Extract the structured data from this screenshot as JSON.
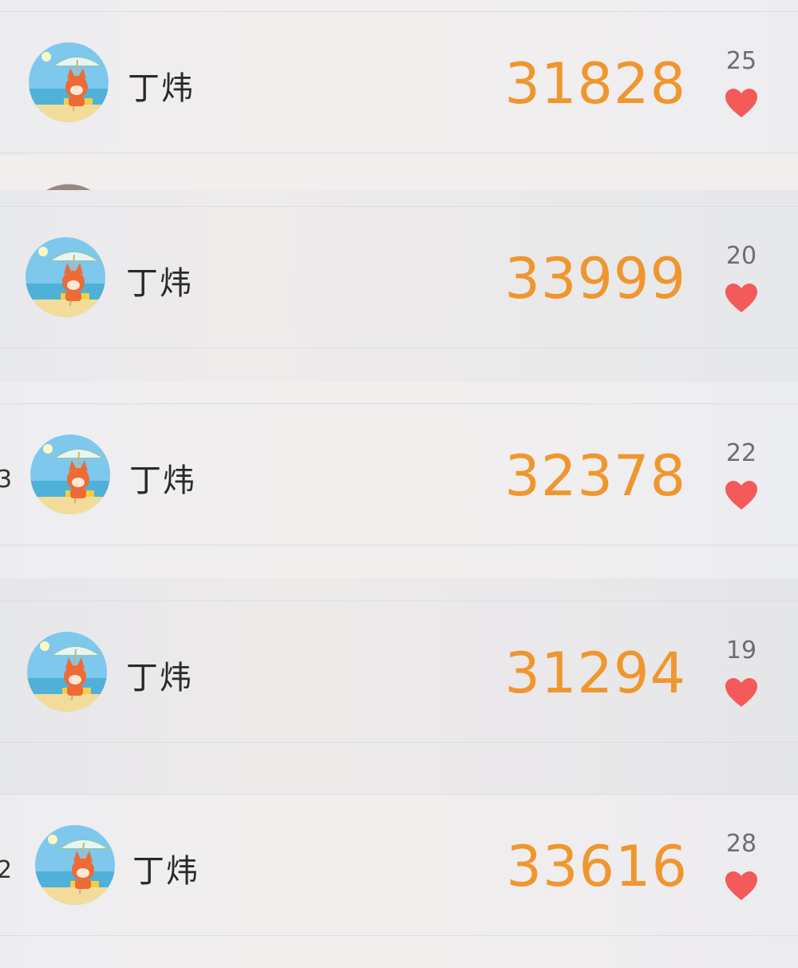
{
  "rows": [
    {
      "name": "丁炜",
      "steps": "31828",
      "likes": "25",
      "rank_fragment": ""
    },
    {
      "name": "丁炜",
      "steps": "33999",
      "likes": "20",
      "rank_fragment": ""
    },
    {
      "name": "丁炜",
      "steps": "32378",
      "likes": "22",
      "rank_fragment": "3"
    },
    {
      "name": "丁炜",
      "steps": "31294",
      "likes": "19",
      "rank_fragment": ""
    },
    {
      "name": "丁炜",
      "steps": "33616",
      "likes": "28",
      "rank_fragment": "2"
    }
  ],
  "icons": {
    "avatar": "fox-under-umbrella-avatar-icon",
    "like": "heart-icon"
  },
  "colors": {
    "steps": "#f0962e",
    "heart": "#f45a5a",
    "likes_count": "#6d6d70",
    "name": "#2a2a2a"
  }
}
